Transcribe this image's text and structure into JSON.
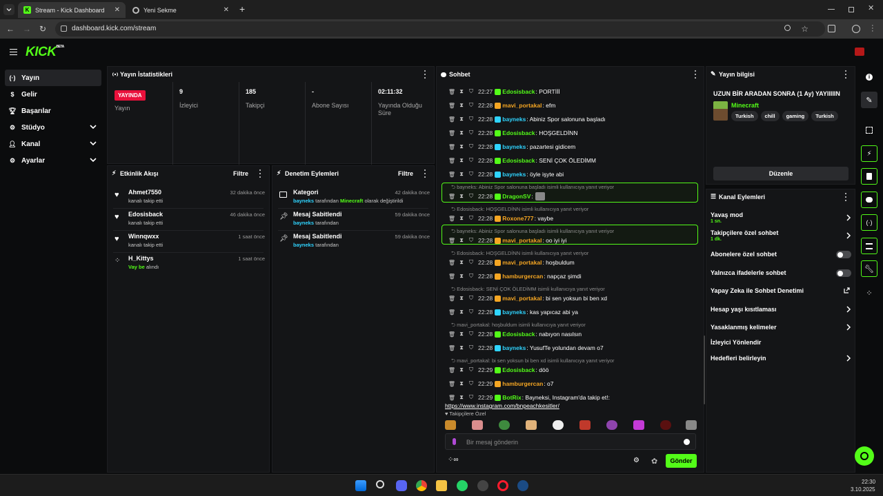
{
  "browser": {
    "tabs": [
      {
        "title": "Stream - Kick Dashboard"
      },
      {
        "title": "Yeni Sekme"
      }
    ],
    "url": "dashboard.kick.com/stream"
  },
  "header": {
    "logo": "KICK",
    "logo_badge": "BETA"
  },
  "sidebar": {
    "items": [
      {
        "label": "Yayın",
        "icon": "broadcast-icon"
      },
      {
        "label": "Gelir",
        "icon": "dollar-icon"
      },
      {
        "label": "Başarılar",
        "icon": "trophy-icon"
      },
      {
        "label": "Stüdyo",
        "icon": "studio-icon"
      },
      {
        "label": "Kanal",
        "icon": "user-icon"
      },
      {
        "label": "Ayarlar",
        "icon": "gear-icon"
      }
    ]
  },
  "stats": {
    "title": "Yayın İstatistikleri",
    "status": "YAYINDA",
    "status_label": "Yayın",
    "viewers": "9",
    "viewers_label": "İzleyici",
    "followers": "185",
    "followers_label": "Takipçi",
    "subs": "-",
    "subs_label": "Abone Sayısı",
    "uptime": "02:11:32",
    "uptime_label": "Yayında Olduğu Süre"
  },
  "activity": {
    "title": "Etkinlik Akışı",
    "filter": "Filtre",
    "items": [
      {
        "name": "Ahmet7550",
        "desc": "kanalı takip etti",
        "time": "32 dakika önce"
      },
      {
        "name": "Edosisback",
        "desc": "kanalı takip etti",
        "time": "46 dakika önce"
      },
      {
        "name": "Winnqwxx",
        "desc": "kanalı takip etti",
        "time": "1 saat önce"
      },
      {
        "name": "H_Kittys",
        "desc_highlight": "Vay be",
        "desc": "alındı",
        "time": "1 saat önce"
      }
    ]
  },
  "moderation": {
    "title": "Denetim Eylemleri",
    "filter": "Filtre",
    "items": [
      {
        "title": "Kategori",
        "user": "bayneks",
        "mid": "tarafından",
        "hl": "Minecraft",
        "rest": "olarak değiştirildi",
        "time": "42 dakika önce"
      },
      {
        "title": "Mesaj Sabitlendi",
        "user": "bayneks",
        "mid": "tarafından",
        "time": "59 dakika önce"
      },
      {
        "title": "Mesaj Sabitlendi",
        "user": "bayneks",
        "mid": "tarafından",
        "time": "59 dakika önce"
      }
    ]
  },
  "chat": {
    "title": "Sohbet",
    "messages": [
      {
        "time": "22:27",
        "user": "Edosisback",
        "color": "#53fc18",
        "text": "PORTİİİ"
      },
      {
        "time": "22:28",
        "user": "mavi_portakal",
        "color": "#f5a623",
        "text": "efm"
      },
      {
        "time": "22:28",
        "user": "bayneks",
        "color": "#2fd4ff",
        "text": "Abiniz Spor salonuna başladı"
      },
      {
        "time": "22:28",
        "user": "Edosisback",
        "color": "#53fc18",
        "text": "HOŞGELDİNN"
      },
      {
        "time": "22:28",
        "user": "bayneks",
        "color": "#2fd4ff",
        "text": "pazartesi gidicem"
      },
      {
        "time": "22:28",
        "user": "Edosisback",
        "color": "#53fc18",
        "text": "SENİ ÇOK ÖLEDİMM"
      },
      {
        "time": "22:28",
        "user": "bayneks",
        "color": "#2fd4ff",
        "text": "öyle işyte abi"
      },
      {
        "reply": "bayneks: Abiniz Spor salonuna başladı isimli kullanıcıya yanıt veriyor",
        "time": "22:28",
        "user": "DragonSV",
        "color": "#53fc18",
        "text": ""
      },
      {
        "reply": "Edosisback: HOŞGELDİNN isimli kullanıcıya yanıt veriyor",
        "time": "22:28",
        "user": "Roxone777",
        "color": "#f5a623",
        "text": "vaybe"
      },
      {
        "reply": "bayneks: Abiniz Spor salonuna başladı isimli kullanıcıya yanıt veriyor",
        "time": "22:28",
        "user": "mavi_portakal",
        "color": "#f5a623",
        "text": "oo iyi iyi"
      },
      {
        "reply": "Edosisback: HOŞGELDİNN isimli kullanıcıya yanıt veriyor",
        "time": "22:28",
        "user": "mavi_portakal",
        "color": "#f5a623",
        "text": "hoşbuldum"
      },
      {
        "time": "22:28",
        "user": "hamburgercan",
        "color": "#f5a623",
        "text": "napçaz şimdi"
      },
      {
        "reply": "Edosisback: SENİ ÇOK ÖLEDİMM isimli kullanıcıya yanıt veriyor",
        "time": "22:28",
        "user": "mavi_portakal",
        "color": "#f5a623",
        "text": "bi sen yoksun bi ben xd"
      },
      {
        "time": "22:28",
        "user": "bayneks",
        "color": "#2fd4ff",
        "text": "kas yapıcaz abi ya"
      },
      {
        "reply": "mavi_portakal: hoşbuldum isimli kullanıcıya yanıt veriyor",
        "time": "22:28",
        "user": "Edosisback",
        "color": "#53fc18",
        "text": "nabıyon nasılsın"
      },
      {
        "time": "22:28",
        "user": "bayneks",
        "color": "#2fd4ff",
        "text": "YusufTe yolundan devam o7"
      },
      {
        "reply": "mavi_portakal: bi sen yoksun bi ben xd isimli kullanıcıya yanıt veriyor",
        "time": "22:29",
        "user": "Edosisback",
        "color": "#53fc18",
        "text": "döö"
      },
      {
        "time": "22:29",
        "user": "hamburgercan",
        "color": "#f5a623",
        "text": "o7"
      },
      {
        "time": "22:29",
        "user": "BotRix",
        "color": "#53fc18",
        "text": "Bayneksi, Instagram'da takip et!:",
        "link": "https://www.instagram.com/bnpeachkesitler/"
      }
    ],
    "emote_label": "Takipçilere Özel",
    "input_placeholder": "Bir mesaj gönderin",
    "send": "Gönder"
  },
  "stream_info": {
    "title": "Yayın bilgisi",
    "stream_title": "UZUN BİR ARADAN SONRA (1 Ay) YAYIIIIIN",
    "category": "Minecraft",
    "tags": [
      "Turkish",
      "chill",
      "gaming",
      "Turkish"
    ],
    "edit": "Düzenle"
  },
  "channel_actions": {
    "title": "Kanal Eylemleri",
    "items": [
      {
        "label": "Yavaş mod",
        "sub": "1 sn.",
        "control": "chevron"
      },
      {
        "label": "Takipçilere özel sohbet",
        "sub": "1 dk.",
        "control": "chevron"
      },
      {
        "label": "Abonelere özel sohbet",
        "control": "toggle",
        "on": false
      },
      {
        "label": "Yalnızca ifadelerle sohbet",
        "control": "toggle",
        "on": false
      },
      {
        "label": "Yapay Zeka ile Sohbet Denetimi",
        "control": "external"
      },
      {
        "label": "Hesap yaşı kısıtlaması",
        "control": "chevron"
      },
      {
        "label": "Yasaklanmış kelimeler",
        "control": "chevron"
      },
      {
        "label": "İzleyici Yönlendir",
        "control": "none"
      },
      {
        "label": "Hedefleri belirleyin",
        "control": "chevron"
      }
    ]
  },
  "taskbar": {
    "time": "22:30",
    "date": "3.10.2025"
  },
  "colors": {
    "accent": "#53fc18",
    "live": "#e9113c",
    "panel": "#141517",
    "bg": "#0b0c0d"
  }
}
